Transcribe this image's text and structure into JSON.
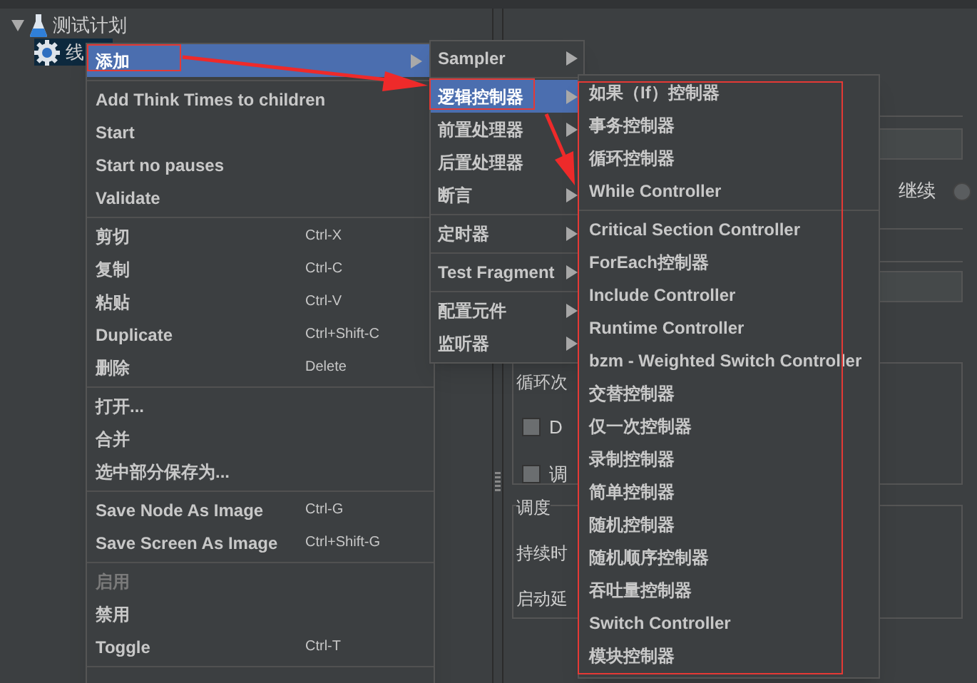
{
  "tree": {
    "items": [
      {
        "label": "测试计划",
        "expanded": true,
        "selected": false,
        "children": [
          {
            "label": "线",
            "selected": true
          }
        ]
      }
    ]
  },
  "panel": {
    "action": {
      "label": "继续",
      "selected": false
    },
    "loop_label": "循环次",
    "checkboxes": [
      {
        "label": "D",
        "checked": false
      },
      {
        "label": "调",
        "checked": false
      }
    ],
    "scheduler": {
      "title": "调度",
      "fields": [
        "持续时",
        "启动延"
      ]
    }
  },
  "context_menu": {
    "groups": [
      [
        {
          "label": "添加",
          "submenu": true,
          "selected": true,
          "disabled": false
        }
      ],
      [
        {
          "label": "Add Think Times to children",
          "submenu": false,
          "selected": false,
          "disabled": false
        },
        {
          "label": "Start",
          "submenu": false,
          "selected": false,
          "disabled": false
        },
        {
          "label": "Start no pauses",
          "submenu": false,
          "selected": false,
          "disabled": false
        },
        {
          "label": "Validate",
          "submenu": false,
          "selected": false,
          "disabled": false
        }
      ],
      [
        {
          "label": "剪切",
          "shortcut": "Ctrl-X",
          "submenu": false,
          "selected": false,
          "disabled": false
        },
        {
          "label": "复制",
          "shortcut": "Ctrl-C",
          "submenu": false,
          "selected": false,
          "disabled": false
        },
        {
          "label": "粘贴",
          "shortcut": "Ctrl-V",
          "submenu": false,
          "selected": false,
          "disabled": false
        },
        {
          "label": "Duplicate",
          "shortcut": "Ctrl+Shift-C",
          "submenu": false,
          "selected": false,
          "disabled": false
        },
        {
          "label": "删除",
          "shortcut": "Delete",
          "submenu": false,
          "selected": false,
          "disabled": false
        }
      ],
      [
        {
          "label": "打开...",
          "submenu": false,
          "selected": false,
          "disabled": false
        },
        {
          "label": "合并",
          "submenu": false,
          "selected": false,
          "disabled": false
        },
        {
          "label": "选中部分保存为...",
          "submenu": false,
          "selected": false,
          "disabled": false
        }
      ],
      [
        {
          "label": "Save Node As Image",
          "shortcut": "Ctrl-G",
          "submenu": false,
          "selected": false,
          "disabled": false
        },
        {
          "label": "Save Screen As Image",
          "shortcut": "Ctrl+Shift-G",
          "submenu": false,
          "selected": false,
          "disabled": false
        }
      ],
      [
        {
          "label": "启用",
          "submenu": false,
          "selected": false,
          "disabled": true
        },
        {
          "label": "禁用",
          "submenu": false,
          "selected": false,
          "disabled": false
        },
        {
          "label": "Toggle",
          "shortcut": "Ctrl-T",
          "submenu": false,
          "selected": false,
          "disabled": false
        }
      ]
    ]
  },
  "add_submenu": {
    "groups": [
      [
        {
          "label": "Sampler",
          "submenu": true,
          "selected": false
        }
      ],
      [
        {
          "label": "逻辑控制器",
          "submenu": true,
          "selected": true
        },
        {
          "label": "前置处理器",
          "submenu": true,
          "selected": false
        },
        {
          "label": "后置处理器",
          "submenu": false,
          "selected": false
        },
        {
          "label": "断言",
          "submenu": true,
          "selected": false
        }
      ],
      [
        {
          "label": "定时器",
          "submenu": true,
          "selected": false
        }
      ],
      [
        {
          "label": "Test Fragment",
          "submenu": true,
          "selected": false
        }
      ],
      [
        {
          "label": "配置元件",
          "submenu": true,
          "selected": false
        },
        {
          "label": "监听器",
          "submenu": true,
          "selected": false
        }
      ]
    ]
  },
  "logic_controller_submenu": {
    "groups": [
      [
        "如果（If）控制器",
        "事务控制器",
        "循环控制器",
        "While Controller"
      ],
      [
        "Critical Section Controller",
        "ForEach控制器",
        "Include Controller",
        "Runtime Controller",
        "bzm - Weighted Switch Controller",
        "交替控制器",
        "仅一次控制器",
        "录制控制器",
        "简单控制器",
        "随机控制器",
        "随机顺序控制器",
        "吞吐量控制器",
        "Switch Controller",
        "模块控制器"
      ]
    ]
  }
}
